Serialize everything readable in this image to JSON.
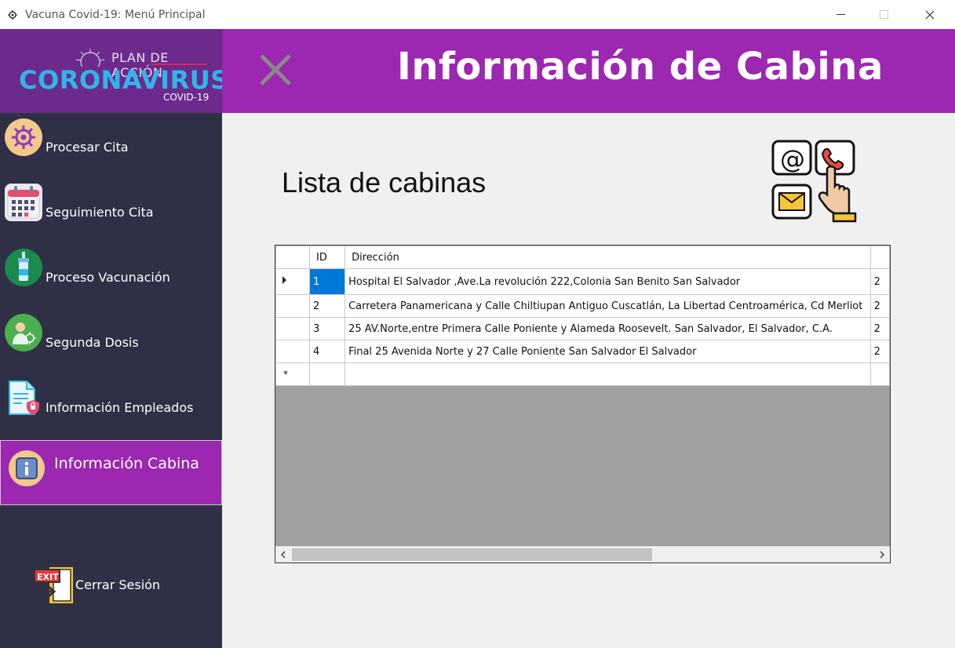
{
  "window": {
    "title": "Vacuna Covid-19: Menú Principal",
    "min": "—",
    "max": "☐",
    "close": "✕"
  },
  "logo": {
    "plan": "PLAN DE ACCIÓN",
    "main": "CORONAVIRUS",
    "sub": "COVID-19"
  },
  "sidebar": {
    "items": [
      {
        "label": "Procesar Cita",
        "icon": "gear-icon"
      },
      {
        "label": "Seguimiento Cita",
        "icon": "calendar-icon"
      },
      {
        "label": "Proceso Vacunación",
        "icon": "vaccine-icon"
      },
      {
        "label": "Segunda Dosis",
        "icon": "person-icon"
      },
      {
        "label": "Información Empleados",
        "icon": "document-icon"
      },
      {
        "label": "Información Cabina",
        "icon": "info-icon"
      }
    ],
    "logout": "Cerrar Sesión"
  },
  "header": {
    "title": "Información de Cabina"
  },
  "section_title": "Lista de cabinas",
  "grid": {
    "columns": [
      "ID",
      "Dirección"
    ],
    "rows": [
      {
        "id": "1",
        "dir": "Hospital El Salvador ,Ave.La revolución 222,Colonia San Benito San Salvador",
        "extra": "2"
      },
      {
        "id": "2",
        "dir": "Carretera Panamericana y Calle Chiltiupan Antiguo Cuscatlán, La Libertad Centroamérica, Cd Merliot",
        "extra": "2"
      },
      {
        "id": "3",
        "dir": "25 AV.Norte,entre Primera Calle Poniente y Alameda Roosevelt. San Salvador, El Salvador, C.A.",
        "extra": "2"
      },
      {
        "id": "4",
        "dir": "Final 25 Avenida Norte y 27 Calle Poniente San Salvador El Salvador",
        "extra": "2"
      }
    ],
    "current_row_marker": "▶",
    "new_row_marker": "*"
  },
  "colors": {
    "sidebar_bg": "#2f3046",
    "header_bg": "#9c27b0",
    "logo_bg": "#6c2a8c",
    "accent_blue": "#2fb6ea"
  }
}
